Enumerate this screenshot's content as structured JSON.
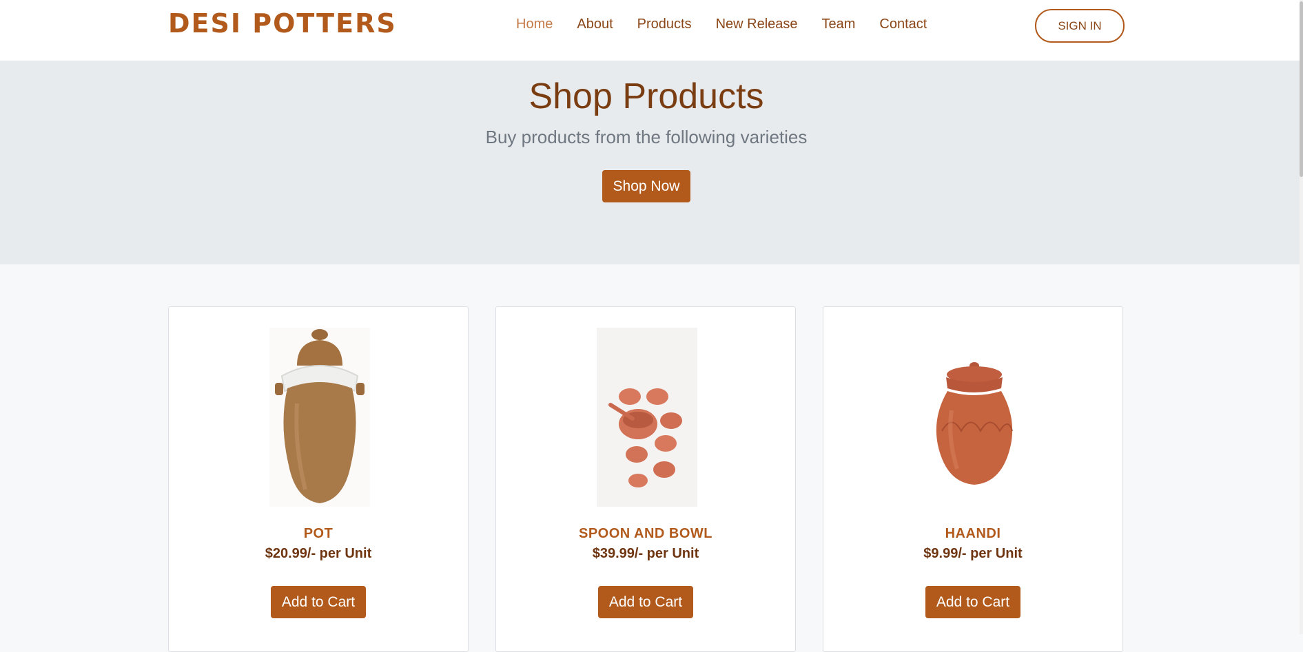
{
  "brand": "DESI POTTERS",
  "nav": {
    "items": [
      "Home",
      "About",
      "Products",
      "New Release",
      "Team",
      "Contact"
    ],
    "active": "Home",
    "signin_label": "SIGN IN"
  },
  "hero": {
    "title": "Shop Products",
    "subtitle": "Buy products from the following varieties",
    "button_label": "Shop Now"
  },
  "products": [
    {
      "name": "POT",
      "price": "$20.99/- per Unit",
      "button_label": "Add to Cart",
      "image": "pot-image"
    },
    {
      "name": "SPOON AND BOWL",
      "price": "$39.99/- per Unit",
      "button_label": "Add to Cart",
      "image": "spoon-and-bowl-image"
    },
    {
      "name": "HAANDI",
      "price": "$9.99/- per Unit",
      "button_label": "Add to Cart",
      "image": "haandi-image"
    }
  ],
  "colors": {
    "brand": "#b15a1c",
    "dark_brown": "#7a3d12",
    "hero_bg": "#e8ebee",
    "page_bg": "#f7f8f9"
  }
}
